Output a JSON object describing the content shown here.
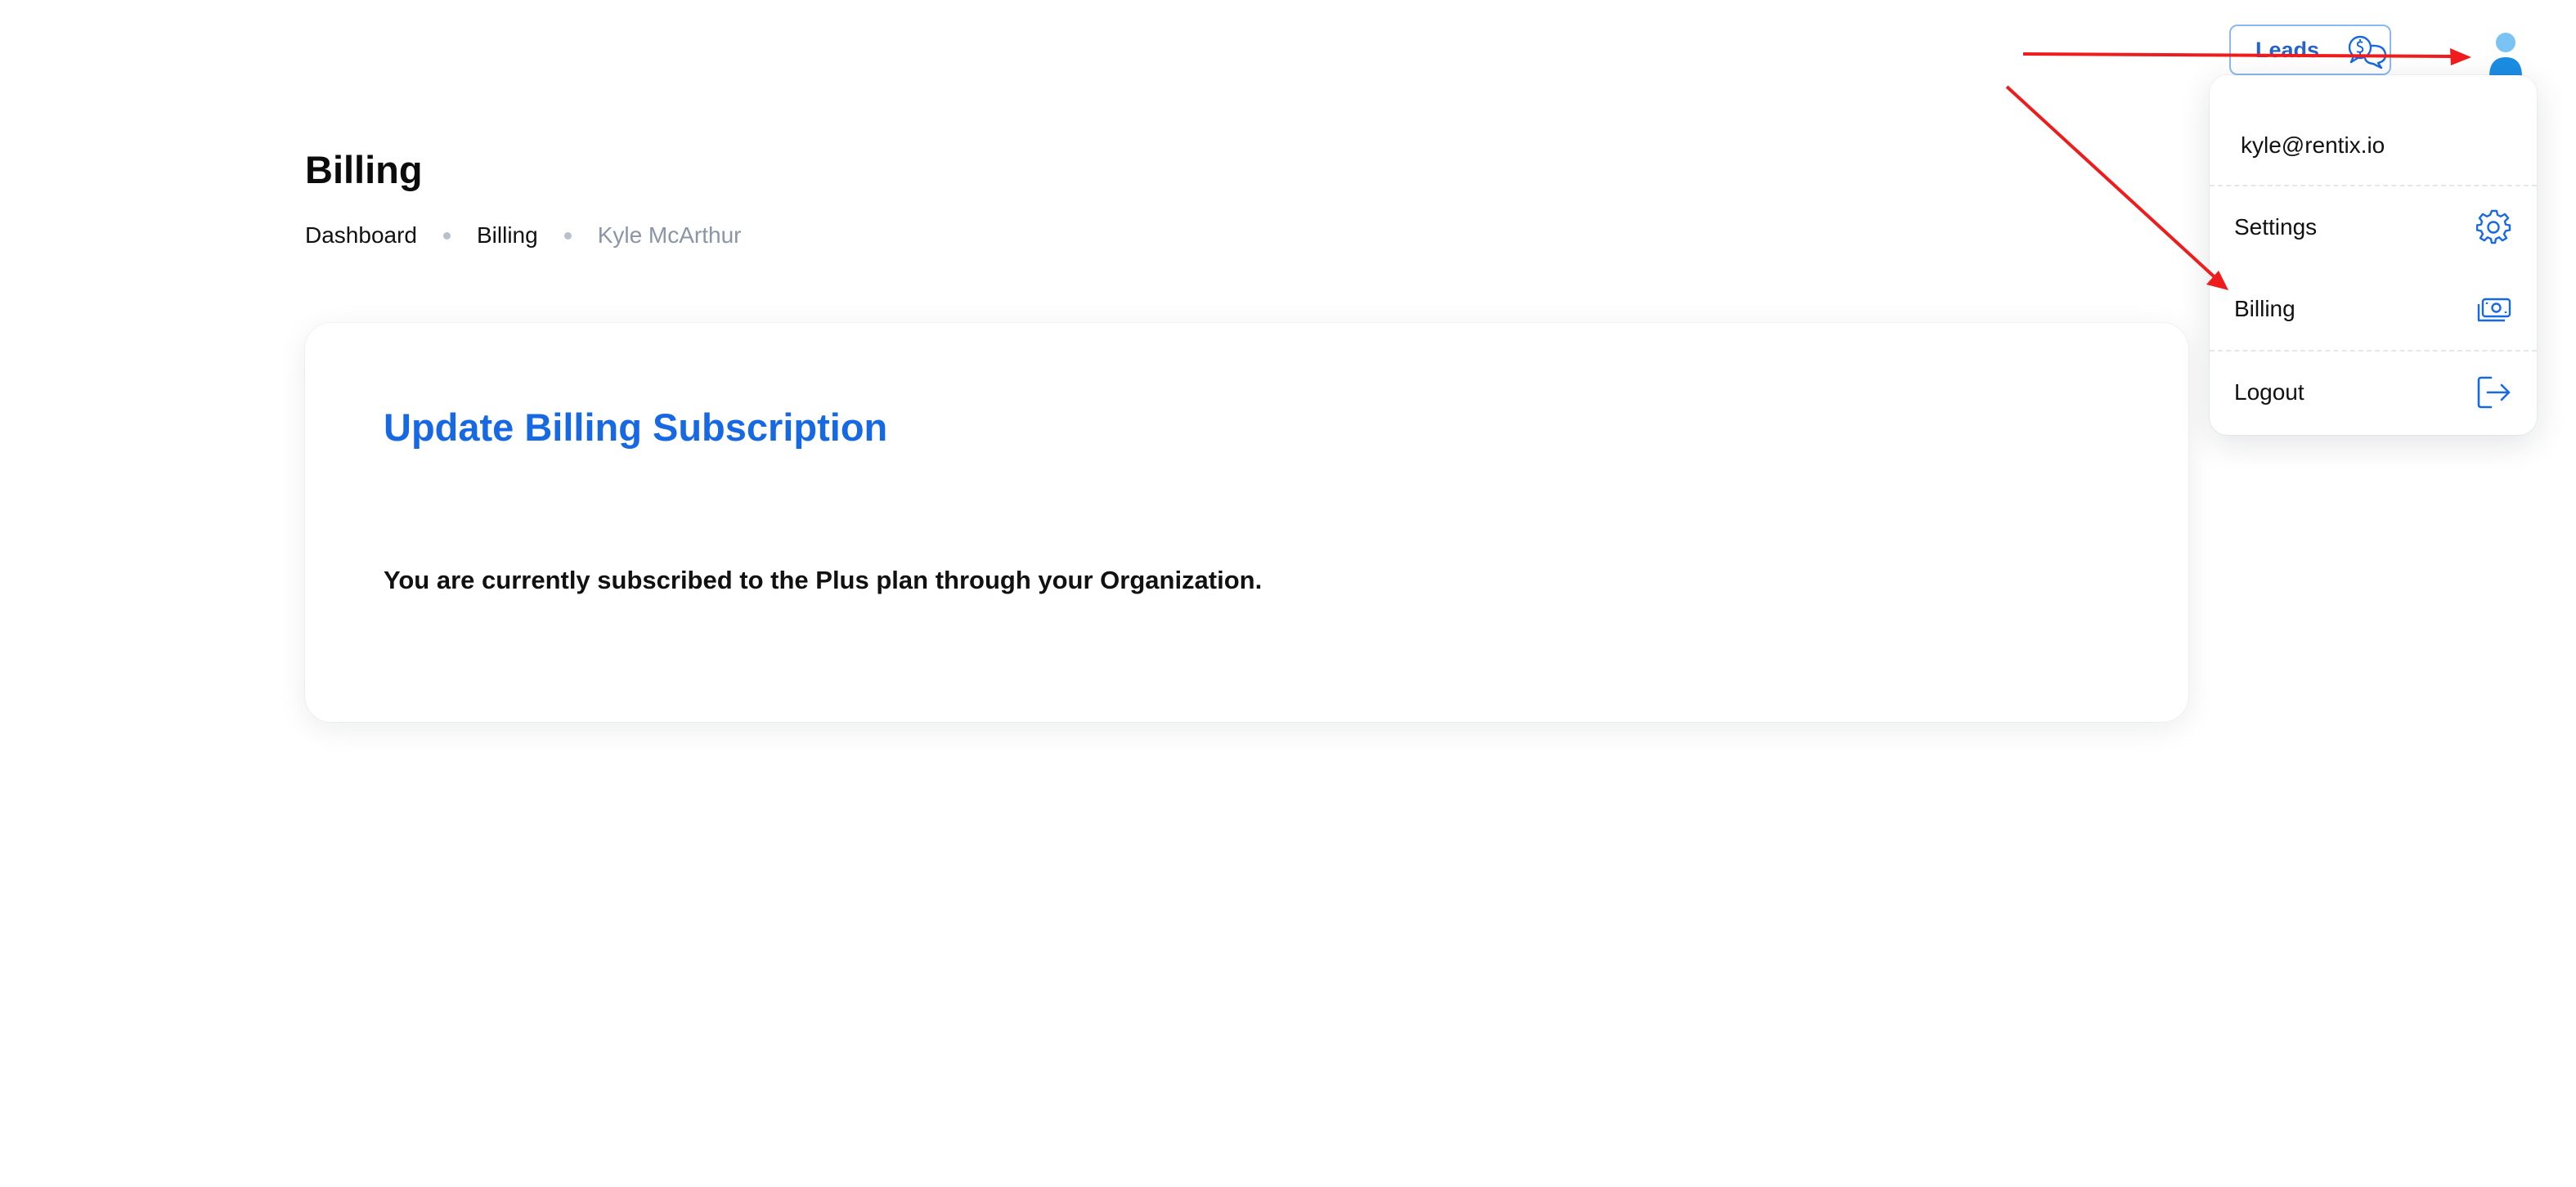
{
  "header": {
    "leads_label": "Leads",
    "icons": {
      "leads": "chat-dollar-icon",
      "avatar": "user-avatar-icon"
    }
  },
  "page": {
    "title": "Billing",
    "breadcrumb": [
      "Dashboard",
      "Billing",
      "Kyle McArthur"
    ]
  },
  "card": {
    "title": "Update Billing Subscription",
    "message": "You are currently subscribed to the Plus plan through your Organization."
  },
  "user_menu": {
    "email": "kyle@rentix.io",
    "items": [
      {
        "label": "Settings",
        "icon": "gear-icon"
      },
      {
        "label": "Billing",
        "icon": "money-icon"
      },
      {
        "label": "Logout",
        "icon": "logout-icon"
      }
    ]
  },
  "colors": {
    "accent": "#1769e3",
    "leads_border": "#8cb8f2",
    "annotation_arrow": "#ee1c1c",
    "muted_text": "#8a95a5"
  }
}
